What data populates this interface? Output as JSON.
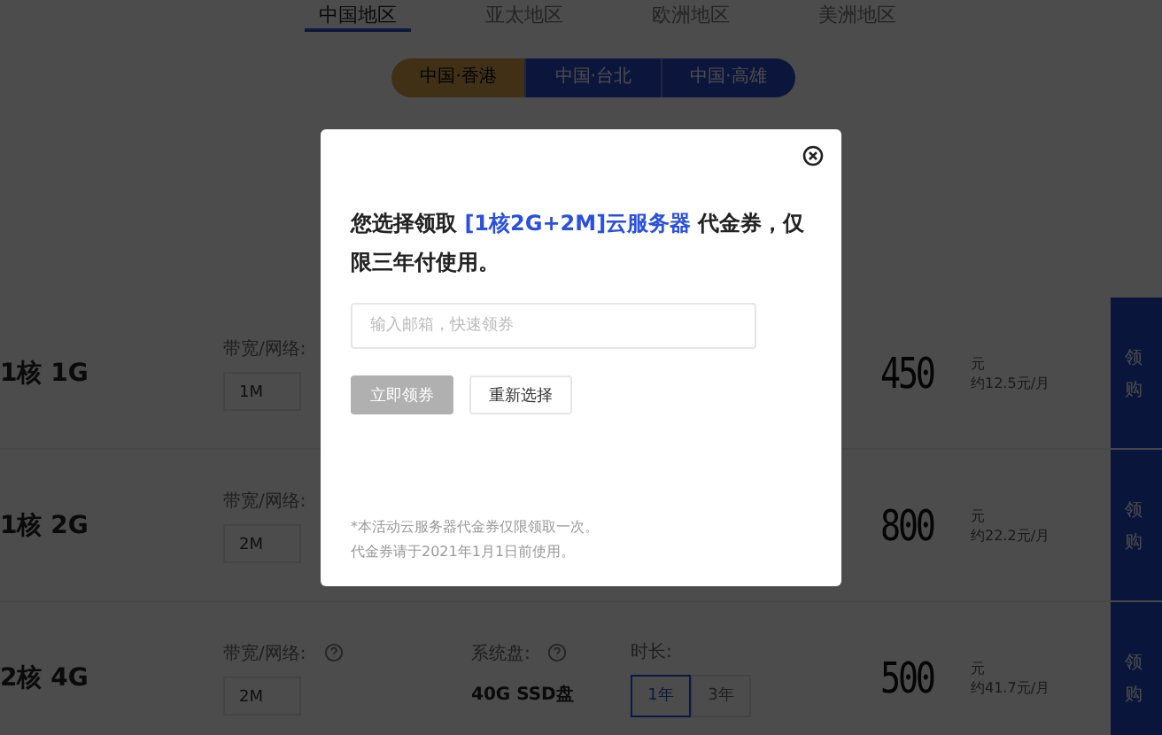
{
  "region_tabs": [
    {
      "label": "中国地区",
      "selected": true
    },
    {
      "label": "亚太地区",
      "selected": false
    },
    {
      "label": "欧洲地区",
      "selected": false
    },
    {
      "label": "美洲地区",
      "selected": false
    }
  ],
  "locations": [
    {
      "label": "中国·香港",
      "selected": true
    },
    {
      "label": "中国·台北",
      "selected": false
    },
    {
      "label": "中国·高雄",
      "selected": false
    }
  ],
  "plans": [
    {
      "name": "1核 1G",
      "bandwidth_label": "带宽/网络:",
      "bandwidth": "1M",
      "price": "450",
      "unit": "元",
      "monthly": "约12.5元/月",
      "action": [
        "领",
        "购"
      ]
    },
    {
      "name": "1核 2G",
      "bandwidth_label": "带宽/网络:",
      "bandwidth": "2M",
      "price": "800",
      "unit": "元",
      "monthly": "约22.2元/月",
      "action": [
        "领",
        "购"
      ]
    },
    {
      "name": "2核 4G",
      "bandwidth_label": "带宽/网络:",
      "bandwidth": "2M",
      "disk_label": "系统盘:",
      "disk": "40G SSD盘",
      "duration_label": "时长:",
      "durations": [
        {
          "label": "1年",
          "selected": true
        },
        {
          "label": "3年",
          "selected": false
        }
      ],
      "price": "500",
      "unit": "元",
      "monthly": "约41.7元/月",
      "action": [
        "领",
        "购"
      ]
    }
  ],
  "modal": {
    "title": [
      {
        "kind": "plain",
        "text": "您选择领取 "
      },
      {
        "kind": "highlight",
        "text": "[1核2G+2M]云服务器"
      },
      {
        "kind": "plain",
        "text": " 代金券，仅限三年付使用。"
      }
    ],
    "email_field": {
      "placeholder": "输入邮箱，快速领券"
    },
    "buttons": [
      {
        "label": "立即领券",
        "disabled": true
      },
      {
        "label": "重新选择",
        "disabled": false
      }
    ],
    "notes": [
      "*本活动云服务器代金券仅限领取一次。",
      "代金券请于2021年1月1日前使用。"
    ]
  }
}
